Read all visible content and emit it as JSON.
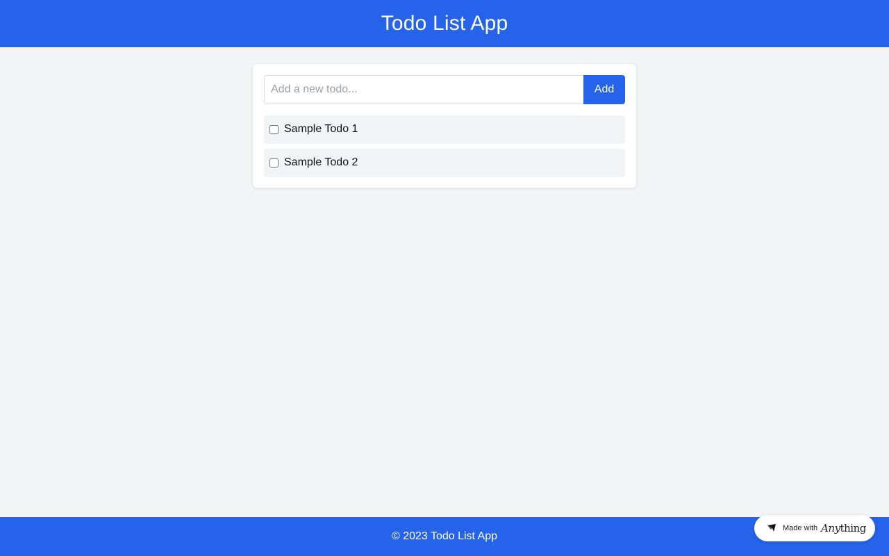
{
  "header": {
    "title": "Todo List App"
  },
  "form": {
    "placeholder": "Add a new todo...",
    "value": "",
    "add_label": "Add"
  },
  "todos": [
    {
      "text": "Sample Todo 1",
      "completed": false
    },
    {
      "text": "Sample Todo 2",
      "completed": false
    }
  ],
  "footer": {
    "text": "© 2023 Todo List App"
  },
  "badge": {
    "prefix": "Made with",
    "brand_italic": "Any",
    "brand_rest": "thing",
    "icon": "anything-logo-icon"
  },
  "colors": {
    "primary": "#2563eb",
    "background": "#f2f4f6",
    "card": "#ffffff",
    "item": "#f2f3f5"
  }
}
